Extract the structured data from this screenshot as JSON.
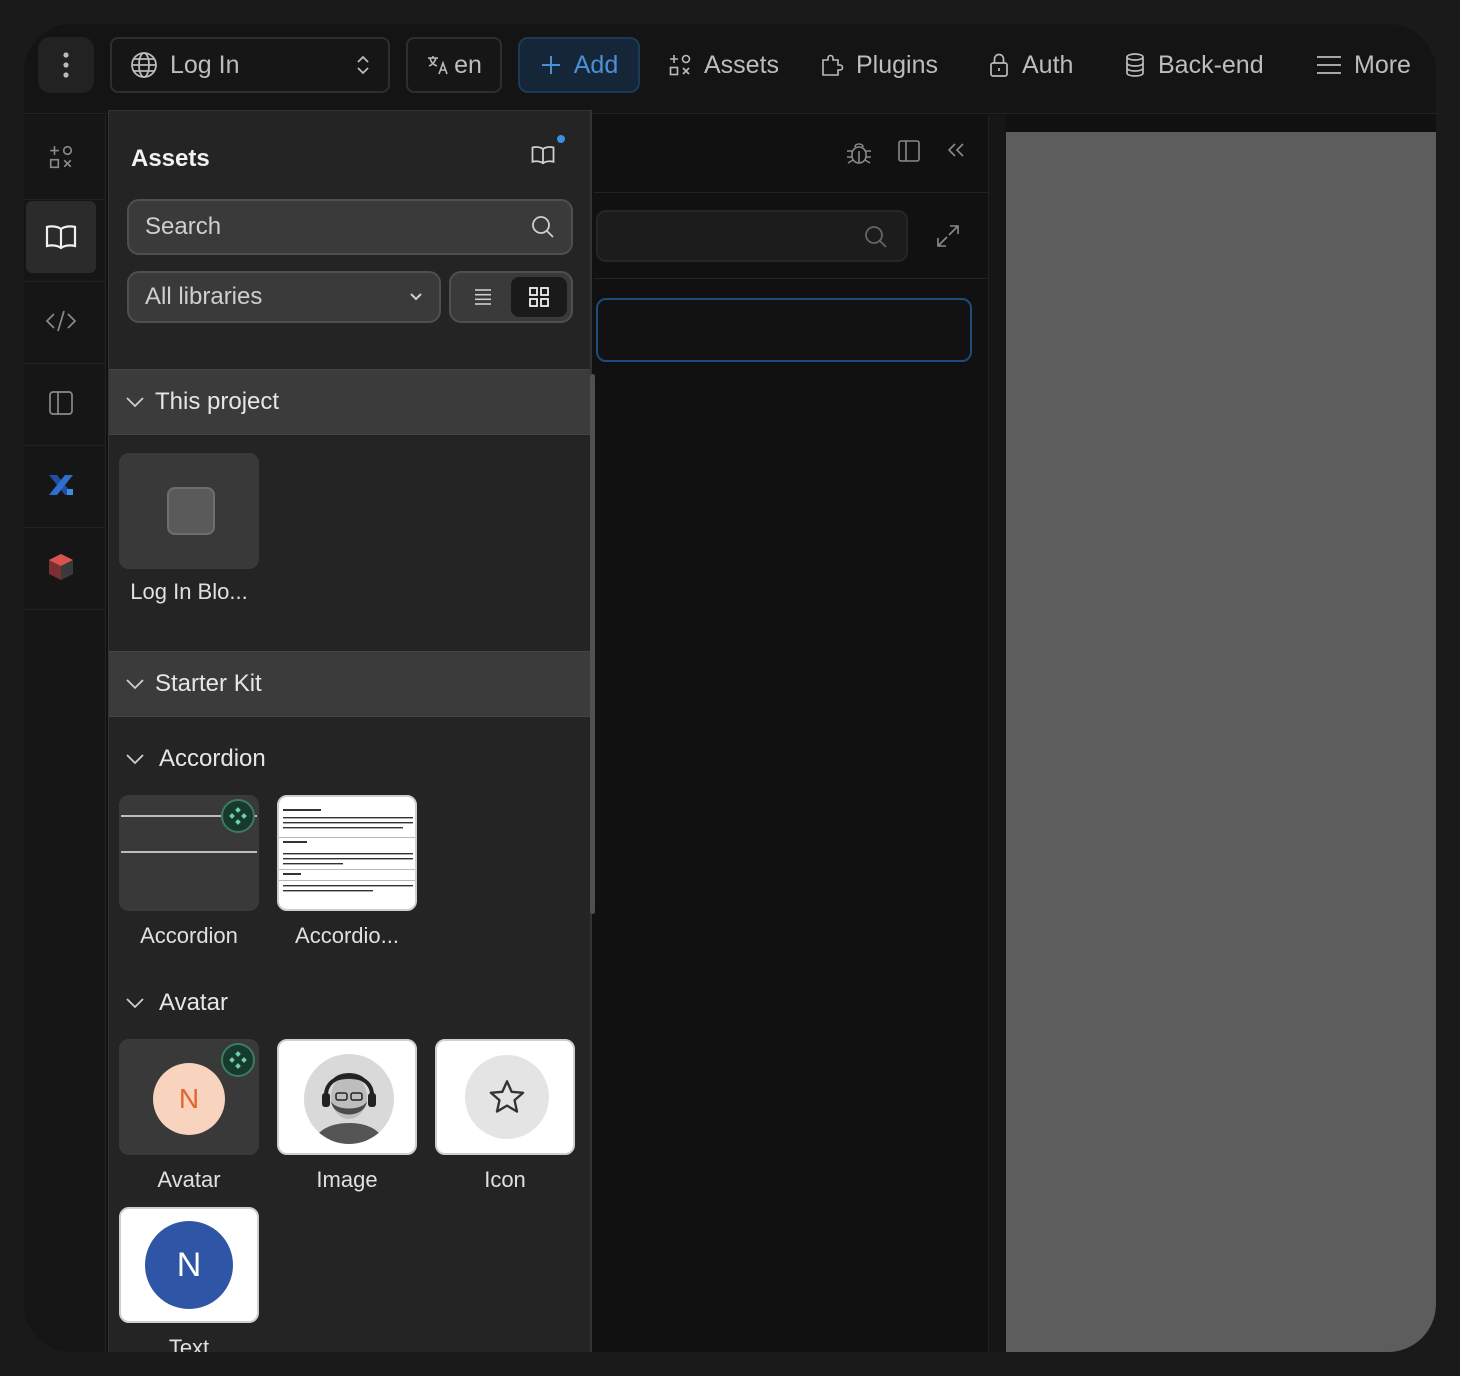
{
  "topbar": {
    "page_name": "Log In",
    "language": "en",
    "add_label": "Add",
    "assets_label": "Assets",
    "plugins_label": "Plugins",
    "auth_label": "Auth",
    "backend_label": "Back-end",
    "more_label": "More"
  },
  "rail": {
    "items": [
      "add-elements-icon",
      "book-icon",
      "code-icon",
      "panel-icon",
      "xano-icon",
      "package-icon"
    ],
    "active": "book-icon"
  },
  "assets_panel": {
    "title": "Assets",
    "search_placeholder": "Search",
    "library_select": "All libraries",
    "view_mode": "grid",
    "sections": [
      {
        "title": "This project",
        "items": [
          {
            "label": "Log In Blo..."
          }
        ]
      },
      {
        "title": "Starter Kit",
        "groups": [
          {
            "title": "Accordion",
            "items": [
              {
                "label": "Accordion"
              },
              {
                "label": "Accordio..."
              }
            ]
          },
          {
            "title": "Avatar",
            "items": [
              {
                "label": "Avatar",
                "initial": "N"
              },
              {
                "label": "Image"
              },
              {
                "label": "Icon"
              },
              {
                "label": "Text",
                "initial": "N"
              }
            ]
          }
        ]
      }
    ]
  },
  "colors": {
    "accent": "#4a90d9",
    "avatar_peach": "#f8d3bd",
    "avatar_orange_text": "#e0662f",
    "avatar_blue": "#2f56a6",
    "canvas": "#5e5d5e"
  }
}
